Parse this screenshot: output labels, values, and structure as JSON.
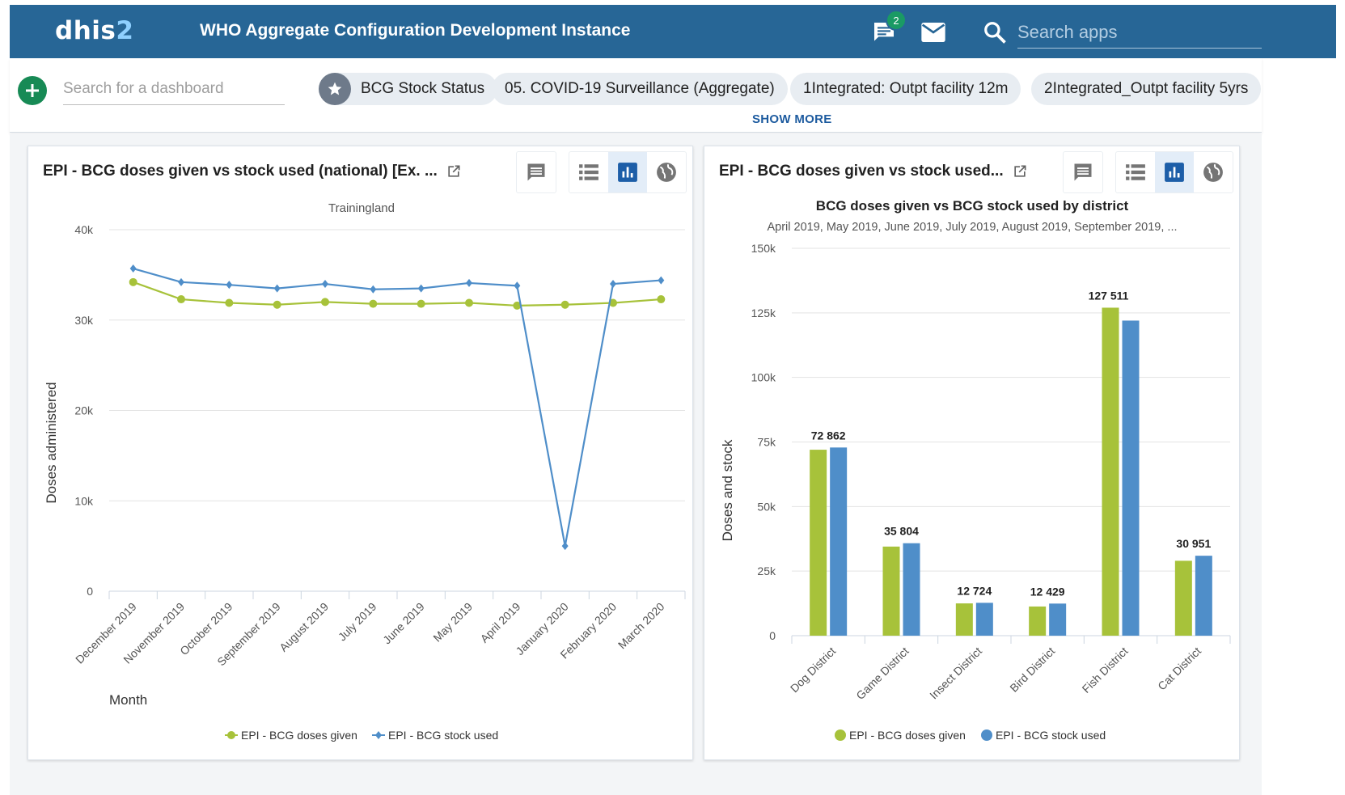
{
  "header": {
    "logo_text": "dhis",
    "logo_num": "2",
    "title": "WHO Aggregate Configuration Development Instance",
    "messages_badge": "2",
    "search_placeholder": "Search apps",
    "icons": [
      "messages-icon",
      "mail-icon",
      "search-icon"
    ]
  },
  "dashboard_bar": {
    "search_placeholder": "Search for a dashboard",
    "chips": [
      {
        "label": "BCG Stock Status",
        "starred": true
      },
      {
        "label": "05. COVID-19 Surveillance (Aggregate)"
      },
      {
        "label": "1Integrated: Outpt facility 12m"
      },
      {
        "label": "2Integrated_Outpt facility 5yrs"
      }
    ],
    "show_more": "SHOW MORE"
  },
  "colors": {
    "header_bg": "#276696",
    "series_green": "#a7c23a",
    "series_blue": "#4f8ec9",
    "accent_green": "#178a55"
  },
  "card1": {
    "title": "EPI - BCG doses given vs stock used (national) [Ex. ...",
    "chart_data": {
      "type": "line",
      "title": "",
      "subtitle": "Trainingland",
      "xlabel": "Month",
      "ylabel": "Doses administered",
      "ylim": [
        0,
        40000
      ],
      "yticks": [
        "0",
        "10k",
        "20k",
        "30k",
        "40k"
      ],
      "categories": [
        "December 2019",
        "November 2019",
        "October 2019",
        "September 2019",
        "August 2019",
        "July 2019",
        "June 2019",
        "May 2019",
        "April 2019",
        "January 2020",
        "February 2020",
        "March 2020"
      ],
      "series": [
        {
          "name": "EPI - BCG doses given",
          "color": "#a7c23a",
          "values": [
            34200,
            32300,
            31900,
            31700,
            32000,
            31800,
            31800,
            31900,
            31600,
            31700,
            31900,
            32300
          ]
        },
        {
          "name": "EPI - BCG stock used",
          "color": "#4f8ec9",
          "values": [
            35700,
            34200,
            33900,
            33500,
            34000,
            33400,
            33500,
            34100,
            33800,
            5000,
            34000,
            34400
          ]
        }
      ],
      "grid": true,
      "legend": "bottom"
    }
  },
  "card2": {
    "title": "EPI - BCG doses given vs stock used...",
    "chart_data": {
      "type": "bar",
      "title": "BCG doses given vs BCG stock used by district",
      "subtitle": "April 2019, May 2019, June 2019, July 2019, August 2019, September 2019, ...",
      "xlabel": "",
      "ylabel": "Doses and stock",
      "ylim": [
        0,
        150000
      ],
      "yticks": [
        "0",
        "25k",
        "50k",
        "75k",
        "100k",
        "125k",
        "150k"
      ],
      "categories": [
        "Dog District",
        "Game District",
        "Insect District",
        "Bird District",
        "Fish District",
        "Cat District"
      ],
      "series": [
        {
          "name": "EPI - BCG doses given",
          "color": "#a7c23a",
          "values": [
            72000,
            34500,
            12500,
            11300,
            127000,
            29000
          ]
        },
        {
          "name": "EPI - BCG stock used",
          "color": "#4f8ec9",
          "values": [
            72862,
            35804,
            12724,
            12429,
            122000,
            30951
          ]
        }
      ],
      "data_labels": [
        "72 862",
        "35 804",
        "12 724",
        "12 429",
        "127 511",
        "30 951"
      ],
      "grid": true,
      "legend": "bottom"
    }
  }
}
